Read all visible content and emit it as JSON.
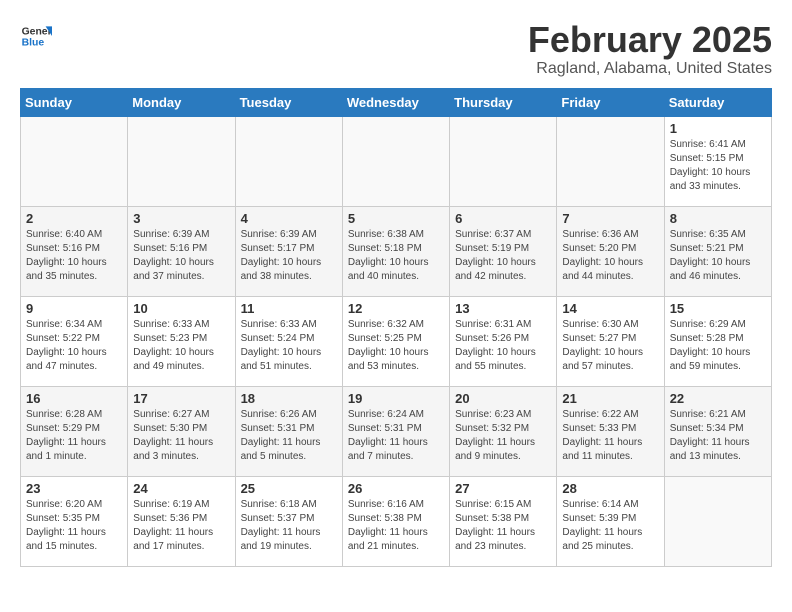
{
  "header": {
    "logo_line1": "General",
    "logo_line2": "Blue",
    "title": "February 2025",
    "subtitle": "Ragland, Alabama, United States"
  },
  "weekdays": [
    "Sunday",
    "Monday",
    "Tuesday",
    "Wednesday",
    "Thursday",
    "Friday",
    "Saturday"
  ],
  "weeks": [
    [
      {
        "day": "",
        "info": ""
      },
      {
        "day": "",
        "info": ""
      },
      {
        "day": "",
        "info": ""
      },
      {
        "day": "",
        "info": ""
      },
      {
        "day": "",
        "info": ""
      },
      {
        "day": "",
        "info": ""
      },
      {
        "day": "1",
        "info": "Sunrise: 6:41 AM\nSunset: 5:15 PM\nDaylight: 10 hours and 33 minutes."
      }
    ],
    [
      {
        "day": "2",
        "info": "Sunrise: 6:40 AM\nSunset: 5:16 PM\nDaylight: 10 hours and 35 minutes."
      },
      {
        "day": "3",
        "info": "Sunrise: 6:39 AM\nSunset: 5:16 PM\nDaylight: 10 hours and 37 minutes."
      },
      {
        "day": "4",
        "info": "Sunrise: 6:39 AM\nSunset: 5:17 PM\nDaylight: 10 hours and 38 minutes."
      },
      {
        "day": "5",
        "info": "Sunrise: 6:38 AM\nSunset: 5:18 PM\nDaylight: 10 hours and 40 minutes."
      },
      {
        "day": "6",
        "info": "Sunrise: 6:37 AM\nSunset: 5:19 PM\nDaylight: 10 hours and 42 minutes."
      },
      {
        "day": "7",
        "info": "Sunrise: 6:36 AM\nSunset: 5:20 PM\nDaylight: 10 hours and 44 minutes."
      },
      {
        "day": "8",
        "info": "Sunrise: 6:35 AM\nSunset: 5:21 PM\nDaylight: 10 hours and 46 minutes."
      }
    ],
    [
      {
        "day": "9",
        "info": "Sunrise: 6:34 AM\nSunset: 5:22 PM\nDaylight: 10 hours and 47 minutes."
      },
      {
        "day": "10",
        "info": "Sunrise: 6:33 AM\nSunset: 5:23 PM\nDaylight: 10 hours and 49 minutes."
      },
      {
        "day": "11",
        "info": "Sunrise: 6:33 AM\nSunset: 5:24 PM\nDaylight: 10 hours and 51 minutes."
      },
      {
        "day": "12",
        "info": "Sunrise: 6:32 AM\nSunset: 5:25 PM\nDaylight: 10 hours and 53 minutes."
      },
      {
        "day": "13",
        "info": "Sunrise: 6:31 AM\nSunset: 5:26 PM\nDaylight: 10 hours and 55 minutes."
      },
      {
        "day": "14",
        "info": "Sunrise: 6:30 AM\nSunset: 5:27 PM\nDaylight: 10 hours and 57 minutes."
      },
      {
        "day": "15",
        "info": "Sunrise: 6:29 AM\nSunset: 5:28 PM\nDaylight: 10 hours and 59 minutes."
      }
    ],
    [
      {
        "day": "16",
        "info": "Sunrise: 6:28 AM\nSunset: 5:29 PM\nDaylight: 11 hours and 1 minute."
      },
      {
        "day": "17",
        "info": "Sunrise: 6:27 AM\nSunset: 5:30 PM\nDaylight: 11 hours and 3 minutes."
      },
      {
        "day": "18",
        "info": "Sunrise: 6:26 AM\nSunset: 5:31 PM\nDaylight: 11 hours and 5 minutes."
      },
      {
        "day": "19",
        "info": "Sunrise: 6:24 AM\nSunset: 5:31 PM\nDaylight: 11 hours and 7 minutes."
      },
      {
        "day": "20",
        "info": "Sunrise: 6:23 AM\nSunset: 5:32 PM\nDaylight: 11 hours and 9 minutes."
      },
      {
        "day": "21",
        "info": "Sunrise: 6:22 AM\nSunset: 5:33 PM\nDaylight: 11 hours and 11 minutes."
      },
      {
        "day": "22",
        "info": "Sunrise: 6:21 AM\nSunset: 5:34 PM\nDaylight: 11 hours and 13 minutes."
      }
    ],
    [
      {
        "day": "23",
        "info": "Sunrise: 6:20 AM\nSunset: 5:35 PM\nDaylight: 11 hours and 15 minutes."
      },
      {
        "day": "24",
        "info": "Sunrise: 6:19 AM\nSunset: 5:36 PM\nDaylight: 11 hours and 17 minutes."
      },
      {
        "day": "25",
        "info": "Sunrise: 6:18 AM\nSunset: 5:37 PM\nDaylight: 11 hours and 19 minutes."
      },
      {
        "day": "26",
        "info": "Sunrise: 6:16 AM\nSunset: 5:38 PM\nDaylight: 11 hours and 21 minutes."
      },
      {
        "day": "27",
        "info": "Sunrise: 6:15 AM\nSunset: 5:38 PM\nDaylight: 11 hours and 23 minutes."
      },
      {
        "day": "28",
        "info": "Sunrise: 6:14 AM\nSunset: 5:39 PM\nDaylight: 11 hours and 25 minutes."
      },
      {
        "day": "",
        "info": ""
      }
    ]
  ]
}
